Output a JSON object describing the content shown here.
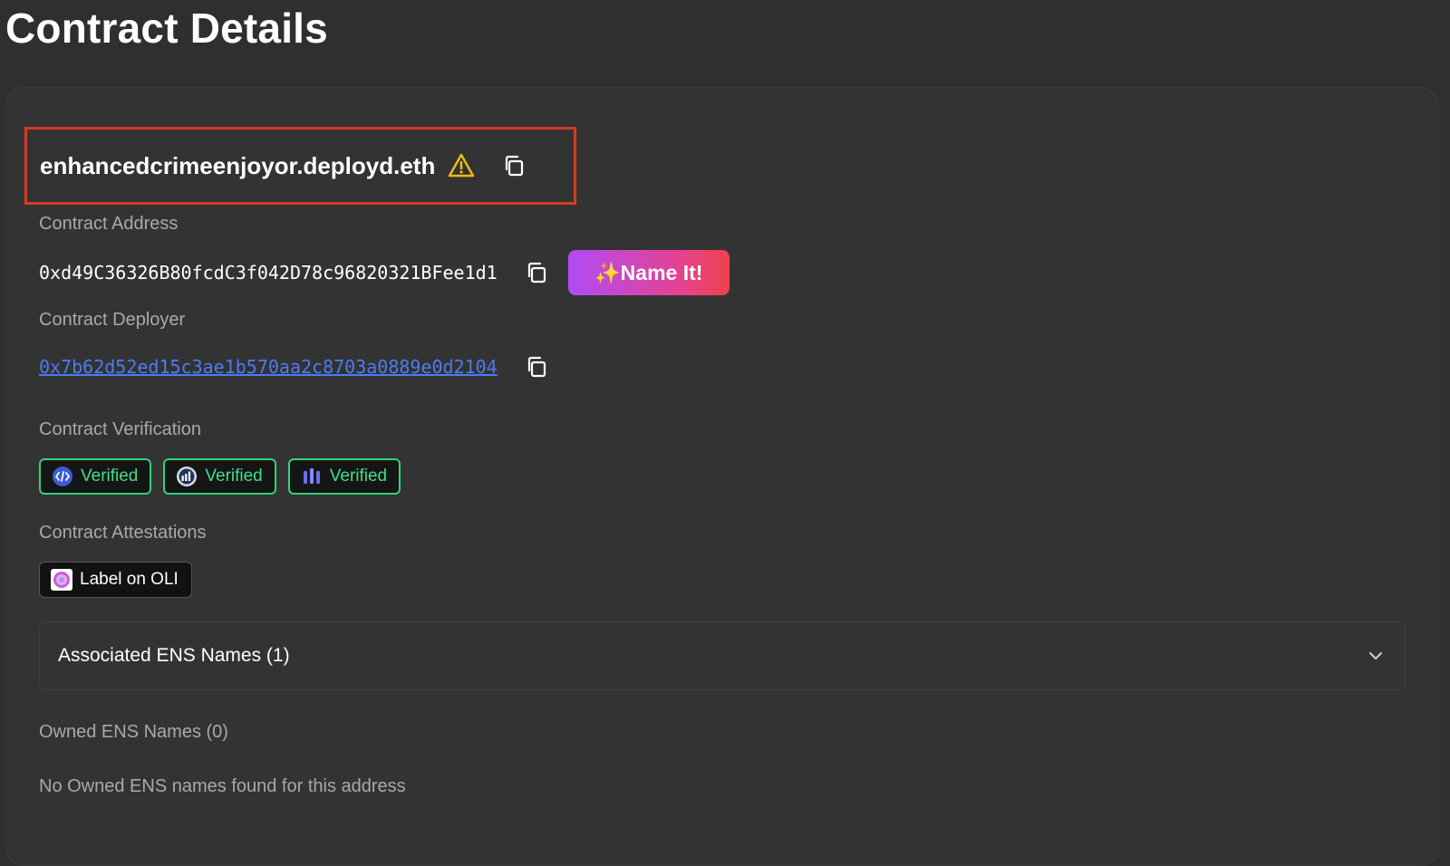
{
  "page": {
    "title": "Contract Details"
  },
  "contract": {
    "ens_name": "enhancedcrimeenjoyor.deployd.eth",
    "address_label": "Contract Address",
    "address": "0xd49C36326B80fcdC3f042D78c96820321BFee1d1",
    "name_it_label": "✨Name It!",
    "deployer_label": "Contract Deployer",
    "deployer": "0x7b62d52ed15c3ae1b570aa2c8703a0889e0d2104",
    "verification_label": "Contract Verification",
    "verification_badges": [
      {
        "label": "Verified",
        "icon": "blockscout-icon"
      },
      {
        "label": "Verified",
        "icon": "etherscan-icon"
      },
      {
        "label": "Verified",
        "icon": "sourcify-icon"
      }
    ],
    "attestations_label": "Contract Attestations",
    "oli_label": "Label on OLI",
    "associated_ens_title": "Associated ENS Names (1)",
    "owned_ens_title": "Owned ENS Names (0)",
    "owned_ens_empty": "No Owned ENS names found for this address"
  },
  "colors": {
    "background": "#2f2f2f",
    "highlight_border": "#d63b22",
    "warning": "#f2b713",
    "link": "#4a7cf2",
    "verified_green": "#2fd47a",
    "name_it_gradient": [
      "#b04cf7",
      "#f0414d"
    ]
  }
}
